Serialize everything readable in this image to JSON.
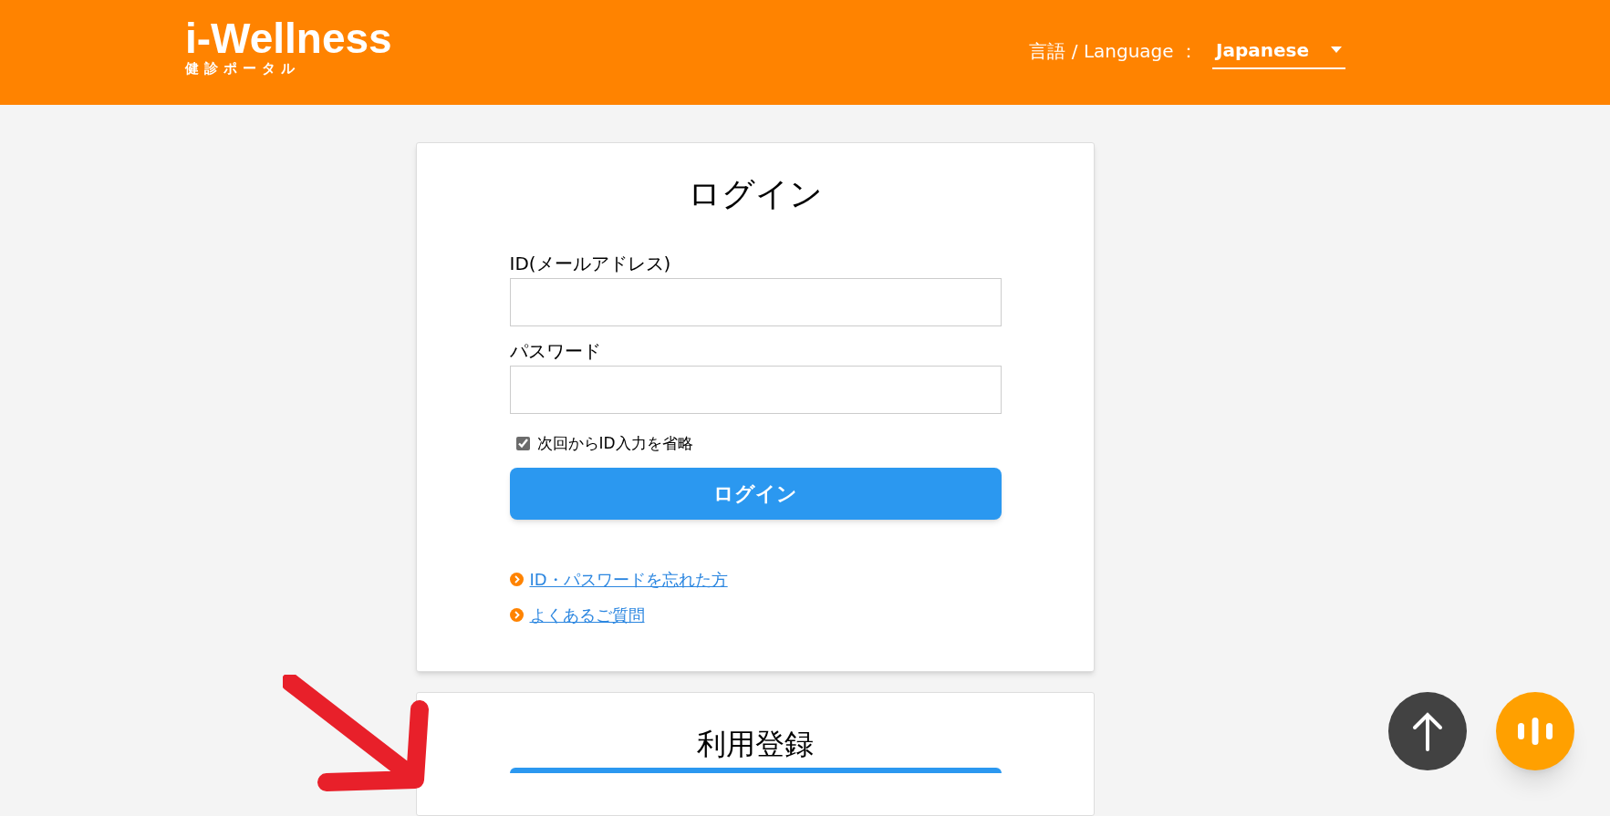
{
  "header": {
    "logo": {
      "title": "i-Wellness",
      "subtitle": "健診ポータル"
    },
    "language": {
      "label": "言語 / Language ：",
      "value": "Japanese"
    }
  },
  "login": {
    "title": "ログイン",
    "fields": [
      {
        "label": "ID(メールアドレス)"
      },
      {
        "label": "パスワード"
      }
    ],
    "remember": {
      "label": "次回からID入力を省略",
      "checked": true
    },
    "button": "ログイン",
    "links": [
      "ID・パスワードを忘れた方",
      "よくあるご質問"
    ]
  },
  "registration": {
    "title": "利用登録"
  }
}
